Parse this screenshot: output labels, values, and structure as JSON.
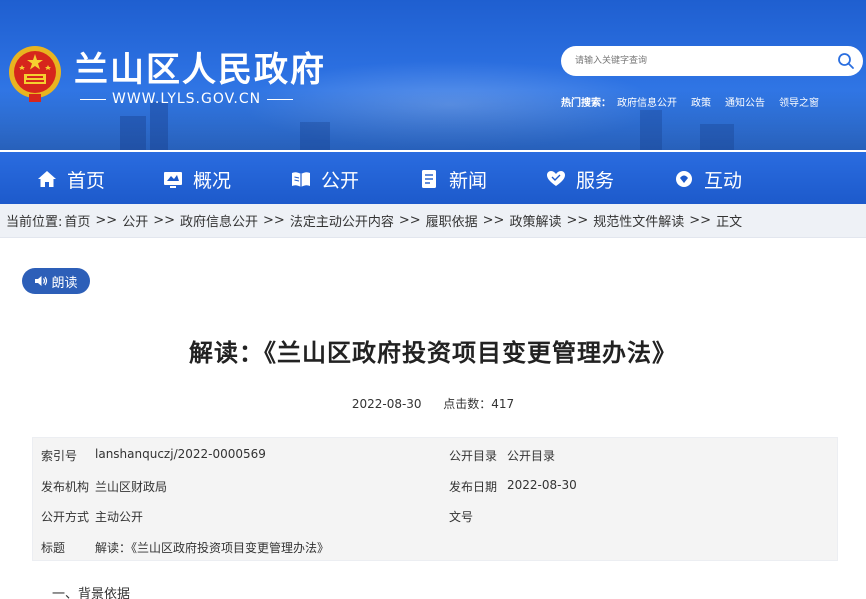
{
  "site": {
    "title": "兰山区人民政府",
    "url": "WWW.LYLS.GOV.CN"
  },
  "search": {
    "placeholder": "请输入关键字查询"
  },
  "hot_search": {
    "label": "热门搜索：",
    "items": [
      "政府信息公开",
      "政策",
      "通知公告",
      "领导之窗"
    ]
  },
  "nav": {
    "items": [
      {
        "label": "首页",
        "icon": "home-icon"
      },
      {
        "label": "概况",
        "icon": "overview-icon"
      },
      {
        "label": "公开",
        "icon": "book-icon"
      },
      {
        "label": "新闻",
        "icon": "document-icon"
      },
      {
        "label": "服务",
        "icon": "heart-hand-icon"
      },
      {
        "label": "互动",
        "icon": "chat-icon"
      }
    ]
  },
  "breadcrumb": {
    "prefix": "当前位置:",
    "items": [
      "首页",
      "公开",
      "政府信息公开",
      "法定主动公开内容",
      "履职依据",
      "政策解读",
      "规范性文件解读",
      "正文"
    ],
    "separator": ">>"
  },
  "read_aloud": {
    "label": "朗读"
  },
  "article": {
    "title": "解读：《兰山区政府投资项目变更管理办法》",
    "date": "2022-08-30",
    "views_label": "点击数：",
    "views": "417",
    "section_1": "一、背景依据"
  },
  "info": {
    "index_label": "索引号",
    "index_value": "lanshanquczj/2022-0000569",
    "catalog_label": "公开目录",
    "catalog_value": "公开目录",
    "org_label": "发布机构",
    "org_value": "兰山区财政局",
    "pubdate_label": "发布日期",
    "pubdate_value": "2022-08-30",
    "method_label": "公开方式",
    "method_value": "主动公开",
    "docno_label": "文号",
    "docno_value": "",
    "subject_label": "标题",
    "subject_value": "解读：《兰山区政府投资项目变更管理办法》"
  },
  "colors": {
    "header_blue": "#2b6fe0",
    "nav_blue": "#1d5acb",
    "read_button": "#2d5fb8",
    "breadcrumb_bg": "#eef1f6",
    "info_bg": "#f4f4f4"
  }
}
